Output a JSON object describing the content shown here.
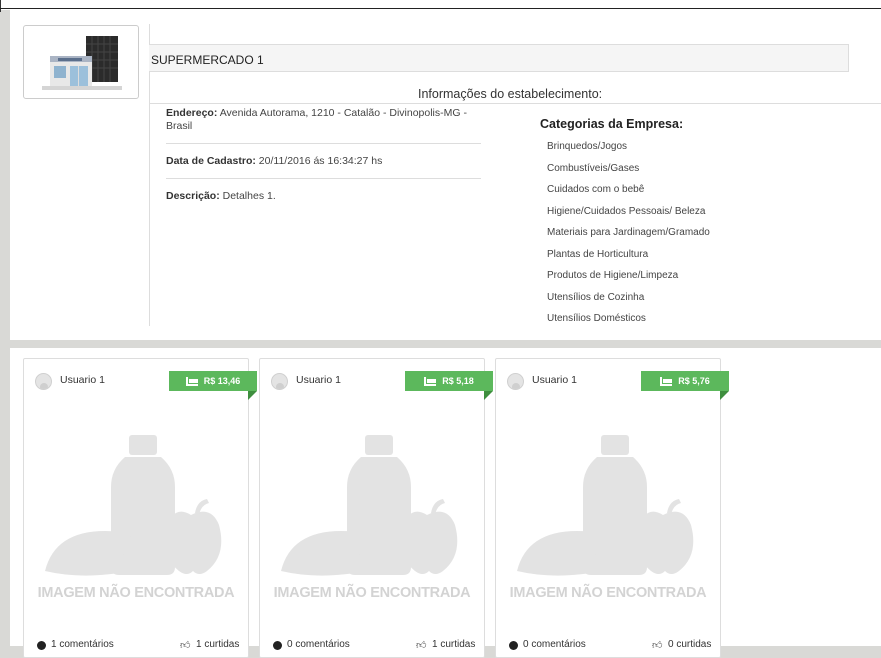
{
  "store": {
    "name": "SUPERMERCADO 1",
    "info_title": "Informações do estabelecimento:",
    "address_label": "Endereço:",
    "address_value": "Avenida Autorama, 1210 - Catalão - Divinopolis-MG - Brasil",
    "date_label": "Data de Cadastro:",
    "date_value": "20/11/2016 ás 16:34:27 hs",
    "desc_label": "Descrição:",
    "desc_value": "Detalhes 1.",
    "categories_title": "Categorias da Empresa:",
    "categories": [
      "Brinquedos/Jogos",
      "Combustíveis/Gases",
      "Cuidados com o bebê",
      "Higiene/Cuidados Pessoais/ Beleza",
      "Materiais para Jardinagem/Gramado",
      "Plantas de Horticultura",
      "Produtos de Higiene/Limpeza",
      "Utensílios de Cozinha",
      "Utensílios Domésticos"
    ]
  },
  "products": [
    {
      "user": "Usuario 1",
      "price": "R$ 13,46",
      "no_image": "IMAGEM NÃO ENCONTRADA",
      "comments": "1 comentários",
      "likes": "1 curtidas"
    },
    {
      "user": "Usuario 1",
      "price": "R$ 5,18",
      "no_image": "IMAGEM NÃO ENCONTRADA",
      "comments": "0 comentários",
      "likes": "1 curtidas"
    },
    {
      "user": "Usuario 1",
      "price": "R$ 5,76",
      "no_image": "IMAGEM NÃO ENCONTRADA",
      "comments": "0 comentários",
      "likes": "0 curtidas"
    }
  ],
  "icons": {
    "store_logo": "store-building-icon",
    "avatar": "user-avatar-icon",
    "price_tag": "bed-icon",
    "comments": "comment-dot-icon",
    "likes": "thumbs-up-icon"
  },
  "colors": {
    "price_badge": "#5cb85c",
    "placeholder": "#d3d3d3"
  }
}
